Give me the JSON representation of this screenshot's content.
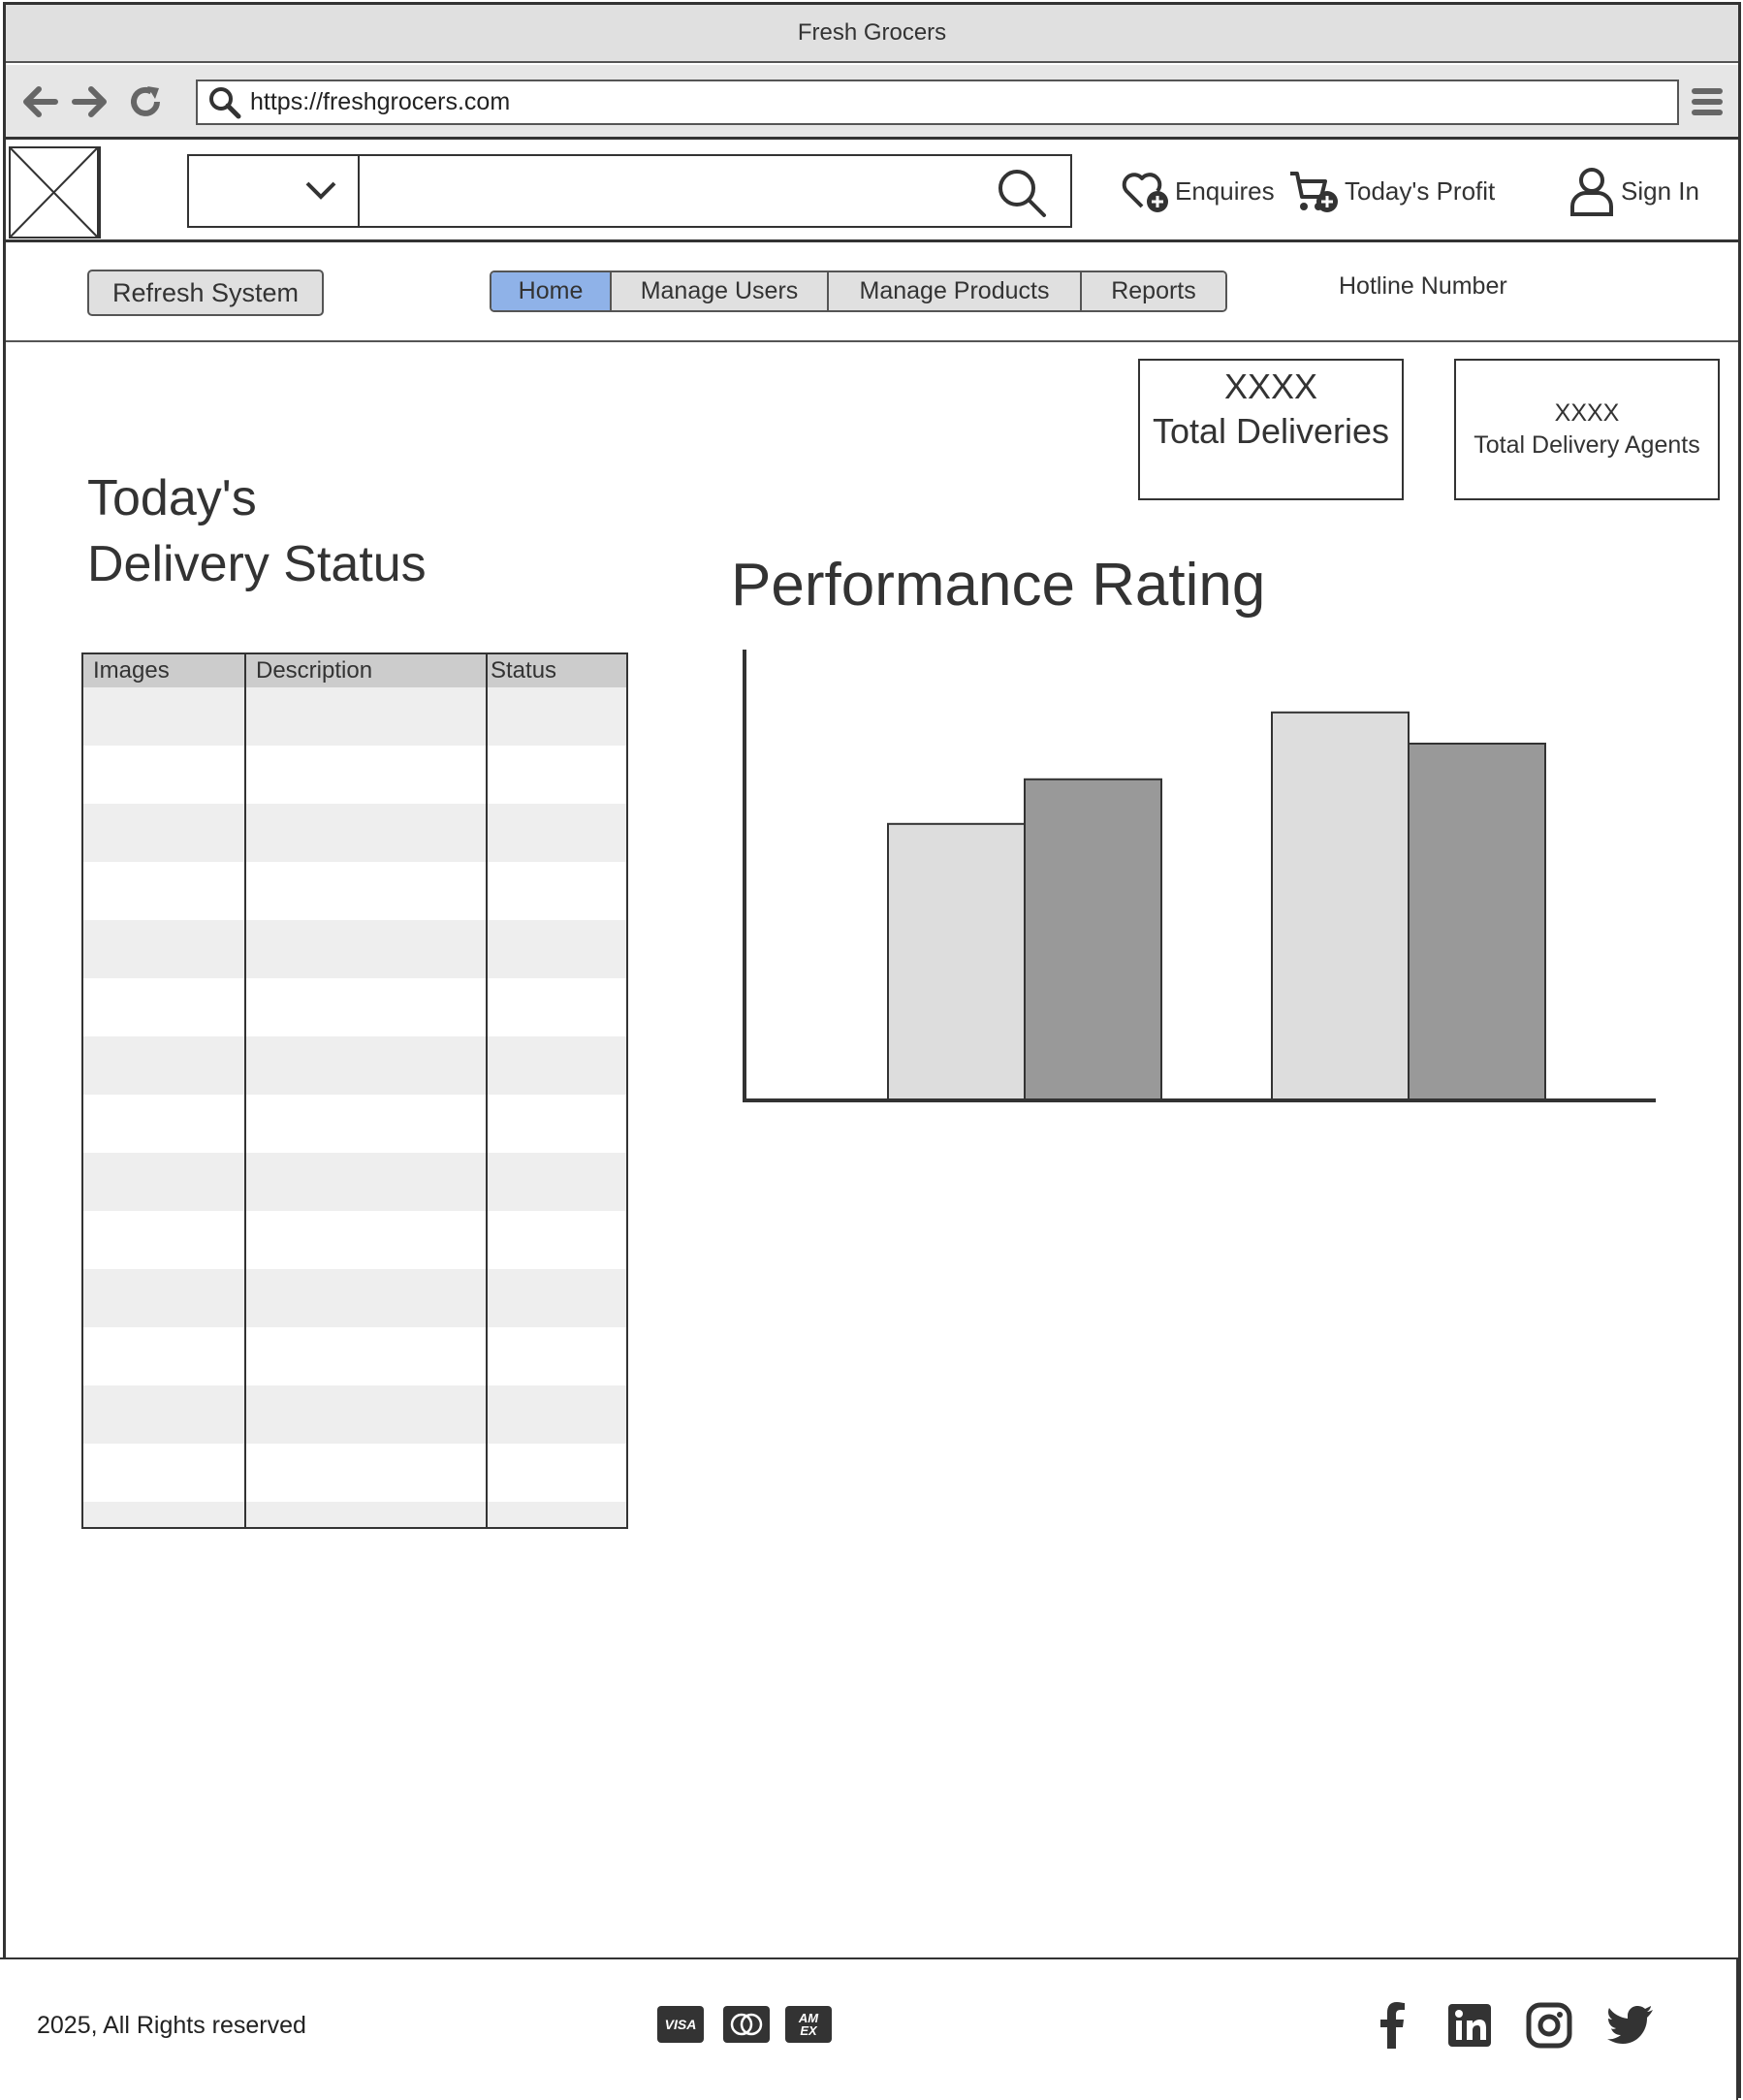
{
  "window": {
    "title": "Fresh Grocers"
  },
  "browser": {
    "url": "https://freshgrocers.com"
  },
  "header": {
    "search_placeholder": "",
    "enquires_label": "Enquires",
    "profit_label": "Today's Profit",
    "signin_label": "Sign In"
  },
  "nav": {
    "refresh_label": "Refresh System",
    "tabs": [
      {
        "label": "Home",
        "active": true
      },
      {
        "label": "Manage Users",
        "active": false
      },
      {
        "label": "Manage Products",
        "active": false
      },
      {
        "label": "Reports",
        "active": false
      }
    ],
    "hotline": "Hotline Number"
  },
  "stats": {
    "deliveries_value": "XXXX",
    "deliveries_label": "Total Deliveries",
    "agents_value": "XXXX",
    "agents_label": "Total Delivery Agents"
  },
  "delivery_status": {
    "title_line1": "Today's",
    "title_line2": "Delivery Status",
    "columns": [
      "Images",
      "Description",
      "Status"
    ]
  },
  "performance": {
    "title": "Performance Rating"
  },
  "chart_data": {
    "type": "bar",
    "title": "Performance Rating",
    "xlabel": "",
    "ylabel": "",
    "categories": [
      "",
      ""
    ],
    "series": [
      {
        "values": [
          62,
          87
        ],
        "color": "#dddddd"
      },
      {
        "values": [
          72,
          80
        ],
        "color": "#999999"
      }
    ],
    "ylim": [
      0,
      100
    ],
    "grid": false
  },
  "footer": {
    "copyright": "2025, All Rights reserved",
    "payments": [
      "visa-icon",
      "mastercard-icon",
      "amex-icon"
    ],
    "social": [
      "facebook-icon",
      "linkedin-icon",
      "instagram-icon",
      "twitter-icon"
    ]
  },
  "colors": {
    "active_tab": "#8fb2e8",
    "bar_light": "#dddddd",
    "bar_dark": "#999999"
  }
}
